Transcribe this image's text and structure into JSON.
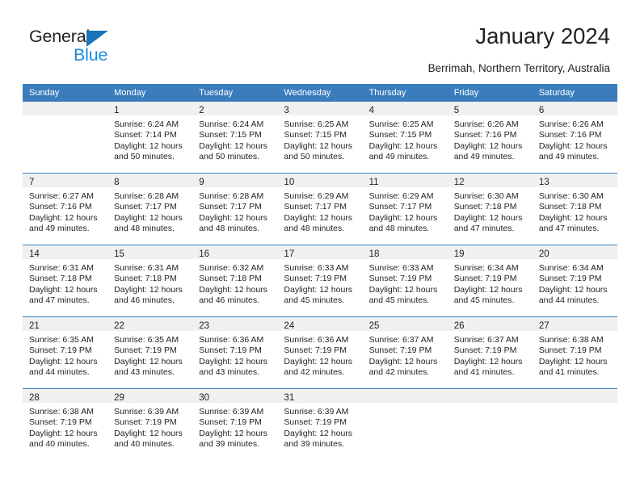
{
  "brand": {
    "name_part1": "General",
    "name_part2": "Blue",
    "triangle_icon": "triangle-logo-icon",
    "accent_color": "#1b8ade"
  },
  "header": {
    "title": "January 2024",
    "location": "Berrimah, Northern Territory, Australia"
  },
  "calendar": {
    "header_bg_color": "#3b7cbd",
    "daynum_bg_color": "#f0f0f0",
    "weekday_headers": [
      "Sunday",
      "Monday",
      "Tuesday",
      "Wednesday",
      "Thursday",
      "Friday",
      "Saturday"
    ],
    "weeks": [
      [
        {
          "day": "",
          "sunrise": "",
          "sunset": "",
          "daylight_line1": "",
          "daylight_line2": ""
        },
        {
          "day": "1",
          "sunrise": "Sunrise: 6:24 AM",
          "sunset": "Sunset: 7:14 PM",
          "daylight_line1": "Daylight: 12 hours",
          "daylight_line2": "and 50 minutes."
        },
        {
          "day": "2",
          "sunrise": "Sunrise: 6:24 AM",
          "sunset": "Sunset: 7:15 PM",
          "daylight_line1": "Daylight: 12 hours",
          "daylight_line2": "and 50 minutes."
        },
        {
          "day": "3",
          "sunrise": "Sunrise: 6:25 AM",
          "sunset": "Sunset: 7:15 PM",
          "daylight_line1": "Daylight: 12 hours",
          "daylight_line2": "and 50 minutes."
        },
        {
          "day": "4",
          "sunrise": "Sunrise: 6:25 AM",
          "sunset": "Sunset: 7:15 PM",
          "daylight_line1": "Daylight: 12 hours",
          "daylight_line2": "and 49 minutes."
        },
        {
          "day": "5",
          "sunrise": "Sunrise: 6:26 AM",
          "sunset": "Sunset: 7:16 PM",
          "daylight_line1": "Daylight: 12 hours",
          "daylight_line2": "and 49 minutes."
        },
        {
          "day": "6",
          "sunrise": "Sunrise: 6:26 AM",
          "sunset": "Sunset: 7:16 PM",
          "daylight_line1": "Daylight: 12 hours",
          "daylight_line2": "and 49 minutes."
        }
      ],
      [
        {
          "day": "7",
          "sunrise": "Sunrise: 6:27 AM",
          "sunset": "Sunset: 7:16 PM",
          "daylight_line1": "Daylight: 12 hours",
          "daylight_line2": "and 49 minutes."
        },
        {
          "day": "8",
          "sunrise": "Sunrise: 6:28 AM",
          "sunset": "Sunset: 7:17 PM",
          "daylight_line1": "Daylight: 12 hours",
          "daylight_line2": "and 48 minutes."
        },
        {
          "day": "9",
          "sunrise": "Sunrise: 6:28 AM",
          "sunset": "Sunset: 7:17 PM",
          "daylight_line1": "Daylight: 12 hours",
          "daylight_line2": "and 48 minutes."
        },
        {
          "day": "10",
          "sunrise": "Sunrise: 6:29 AM",
          "sunset": "Sunset: 7:17 PM",
          "daylight_line1": "Daylight: 12 hours",
          "daylight_line2": "and 48 minutes."
        },
        {
          "day": "11",
          "sunrise": "Sunrise: 6:29 AM",
          "sunset": "Sunset: 7:17 PM",
          "daylight_line1": "Daylight: 12 hours",
          "daylight_line2": "and 48 minutes."
        },
        {
          "day": "12",
          "sunrise": "Sunrise: 6:30 AM",
          "sunset": "Sunset: 7:18 PM",
          "daylight_line1": "Daylight: 12 hours",
          "daylight_line2": "and 47 minutes."
        },
        {
          "day": "13",
          "sunrise": "Sunrise: 6:30 AM",
          "sunset": "Sunset: 7:18 PM",
          "daylight_line1": "Daylight: 12 hours",
          "daylight_line2": "and 47 minutes."
        }
      ],
      [
        {
          "day": "14",
          "sunrise": "Sunrise: 6:31 AM",
          "sunset": "Sunset: 7:18 PM",
          "daylight_line1": "Daylight: 12 hours",
          "daylight_line2": "and 47 minutes."
        },
        {
          "day": "15",
          "sunrise": "Sunrise: 6:31 AM",
          "sunset": "Sunset: 7:18 PM",
          "daylight_line1": "Daylight: 12 hours",
          "daylight_line2": "and 46 minutes."
        },
        {
          "day": "16",
          "sunrise": "Sunrise: 6:32 AM",
          "sunset": "Sunset: 7:18 PM",
          "daylight_line1": "Daylight: 12 hours",
          "daylight_line2": "and 46 minutes."
        },
        {
          "day": "17",
          "sunrise": "Sunrise: 6:33 AM",
          "sunset": "Sunset: 7:19 PM",
          "daylight_line1": "Daylight: 12 hours",
          "daylight_line2": "and 45 minutes."
        },
        {
          "day": "18",
          "sunrise": "Sunrise: 6:33 AM",
          "sunset": "Sunset: 7:19 PM",
          "daylight_line1": "Daylight: 12 hours",
          "daylight_line2": "and 45 minutes."
        },
        {
          "day": "19",
          "sunrise": "Sunrise: 6:34 AM",
          "sunset": "Sunset: 7:19 PM",
          "daylight_line1": "Daylight: 12 hours",
          "daylight_line2": "and 45 minutes."
        },
        {
          "day": "20",
          "sunrise": "Sunrise: 6:34 AM",
          "sunset": "Sunset: 7:19 PM",
          "daylight_line1": "Daylight: 12 hours",
          "daylight_line2": "and 44 minutes."
        }
      ],
      [
        {
          "day": "21",
          "sunrise": "Sunrise: 6:35 AM",
          "sunset": "Sunset: 7:19 PM",
          "daylight_line1": "Daylight: 12 hours",
          "daylight_line2": "and 44 minutes."
        },
        {
          "day": "22",
          "sunrise": "Sunrise: 6:35 AM",
          "sunset": "Sunset: 7:19 PM",
          "daylight_line1": "Daylight: 12 hours",
          "daylight_line2": "and 43 minutes."
        },
        {
          "day": "23",
          "sunrise": "Sunrise: 6:36 AM",
          "sunset": "Sunset: 7:19 PM",
          "daylight_line1": "Daylight: 12 hours",
          "daylight_line2": "and 43 minutes."
        },
        {
          "day": "24",
          "sunrise": "Sunrise: 6:36 AM",
          "sunset": "Sunset: 7:19 PM",
          "daylight_line1": "Daylight: 12 hours",
          "daylight_line2": "and 42 minutes."
        },
        {
          "day": "25",
          "sunrise": "Sunrise: 6:37 AM",
          "sunset": "Sunset: 7:19 PM",
          "daylight_line1": "Daylight: 12 hours",
          "daylight_line2": "and 42 minutes."
        },
        {
          "day": "26",
          "sunrise": "Sunrise: 6:37 AM",
          "sunset": "Sunset: 7:19 PM",
          "daylight_line1": "Daylight: 12 hours",
          "daylight_line2": "and 41 minutes."
        },
        {
          "day": "27",
          "sunrise": "Sunrise: 6:38 AM",
          "sunset": "Sunset: 7:19 PM",
          "daylight_line1": "Daylight: 12 hours",
          "daylight_line2": "and 41 minutes."
        }
      ],
      [
        {
          "day": "28",
          "sunrise": "Sunrise: 6:38 AM",
          "sunset": "Sunset: 7:19 PM",
          "daylight_line1": "Daylight: 12 hours",
          "daylight_line2": "and 40 minutes."
        },
        {
          "day": "29",
          "sunrise": "Sunrise: 6:39 AM",
          "sunset": "Sunset: 7:19 PM",
          "daylight_line1": "Daylight: 12 hours",
          "daylight_line2": "and 40 minutes."
        },
        {
          "day": "30",
          "sunrise": "Sunrise: 6:39 AM",
          "sunset": "Sunset: 7:19 PM",
          "daylight_line1": "Daylight: 12 hours",
          "daylight_line2": "and 39 minutes."
        },
        {
          "day": "31",
          "sunrise": "Sunrise: 6:39 AM",
          "sunset": "Sunset: 7:19 PM",
          "daylight_line1": "Daylight: 12 hours",
          "daylight_line2": "and 39 minutes."
        },
        {
          "day": "",
          "sunrise": "",
          "sunset": "",
          "daylight_line1": "",
          "daylight_line2": ""
        },
        {
          "day": "",
          "sunrise": "",
          "sunset": "",
          "daylight_line1": "",
          "daylight_line2": ""
        },
        {
          "day": "",
          "sunrise": "",
          "sunset": "",
          "daylight_line1": "",
          "daylight_line2": ""
        }
      ]
    ]
  }
}
